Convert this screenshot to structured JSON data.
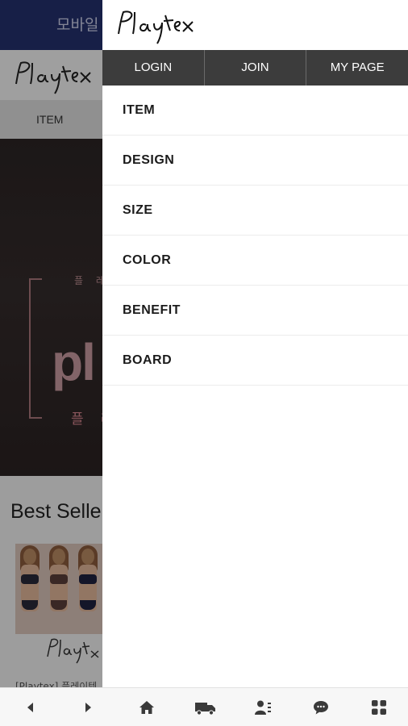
{
  "background_page": {
    "banner_text": "모바일",
    "nav_item": "ITEM",
    "hero_small": "플 레",
    "hero_big": "pl",
    "hero_sub": "플 레",
    "section_title": "Best Selle",
    "product_caption": "[Playtex] 플레이텍"
  },
  "drawer": {
    "logo_text": "Playtex",
    "account": {
      "login": "LOGIN",
      "join": "JOIN",
      "mypage": "MY PAGE"
    },
    "menu": [
      "ITEM",
      "DESIGN",
      "SIZE",
      "COLOR",
      "BENEFIT",
      "BOARD"
    ]
  },
  "bottom_bar": {
    "icons": [
      "back-arrow-icon",
      "forward-arrow-icon",
      "home-icon",
      "delivery-truck-icon",
      "user-list-icon",
      "chat-bubble-icon",
      "grid-menu-icon"
    ]
  },
  "colors": {
    "banner": "#24316e",
    "account_bar": "#3c3c3c",
    "bottom_icons": "#3a3a3a"
  }
}
